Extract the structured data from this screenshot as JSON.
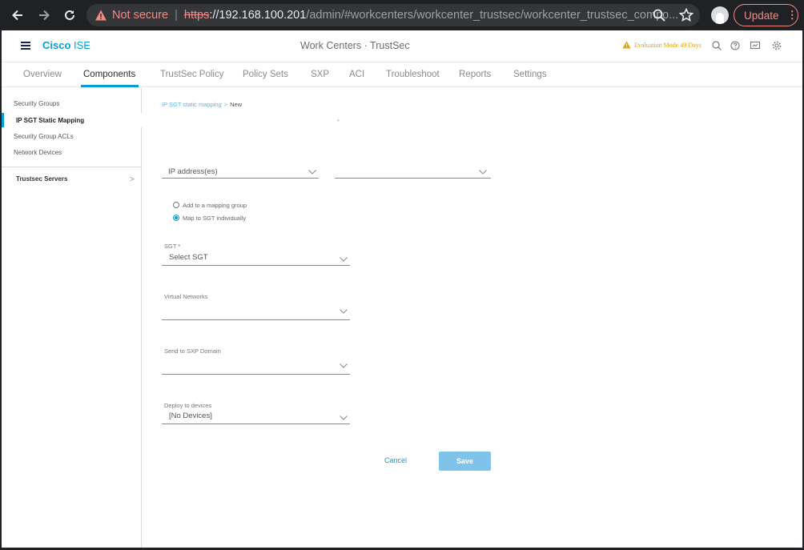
{
  "browser": {
    "not_secure": "Not secure",
    "separator": "|",
    "url_protocol": "https",
    "url_host": "://192.168.100.201",
    "url_path": "/admin/#workcenters/workcenter_trustsec/workcenter_trustsec_compo...",
    "update_label": "Update",
    "update_menu": "⋮"
  },
  "header": {
    "brand_cisco": "Cisco",
    "brand_ise": " ISE",
    "title": "Work Centers · TrustSec",
    "eval_text": "Evaluation Mode 49 Days"
  },
  "tabs": [
    "Overview",
    "Components",
    "TrustSec Policy",
    "Policy Sets",
    "SXP",
    "ACI",
    "Troubleshoot",
    "Reports",
    "Settings"
  ],
  "sidebar": {
    "items": [
      "Security Groups",
      "IP SGT Static Mapping",
      "Security Group ACLs",
      "Network Devices"
    ],
    "section": "Trustsec Servers",
    "chevron": ">"
  },
  "breadcrumb": {
    "parent": "IP SGT static mapping",
    "sep": ">",
    "current": "New"
  },
  "form": {
    "ip_select": "IP address(es)",
    "asterisk": "*",
    "radio_group": "Add to a mapping group",
    "radio_individual": "Map to SGT individually",
    "sgt_label": "SGT",
    "required": "*",
    "sgt_placeholder": "Select SGT",
    "vn_label": "Virtual Networks",
    "sxp_label": "Send to SXP Domain",
    "deploy_label": "Deploy to devices",
    "deploy_value": "[No Devices]",
    "cancel": "Cancel",
    "save": "Save"
  },
  "colors": {
    "accent": "#049fd9",
    "save_bg": "#7fc3ea",
    "warning": "#e8a100",
    "not_secure": "#f28b82"
  }
}
